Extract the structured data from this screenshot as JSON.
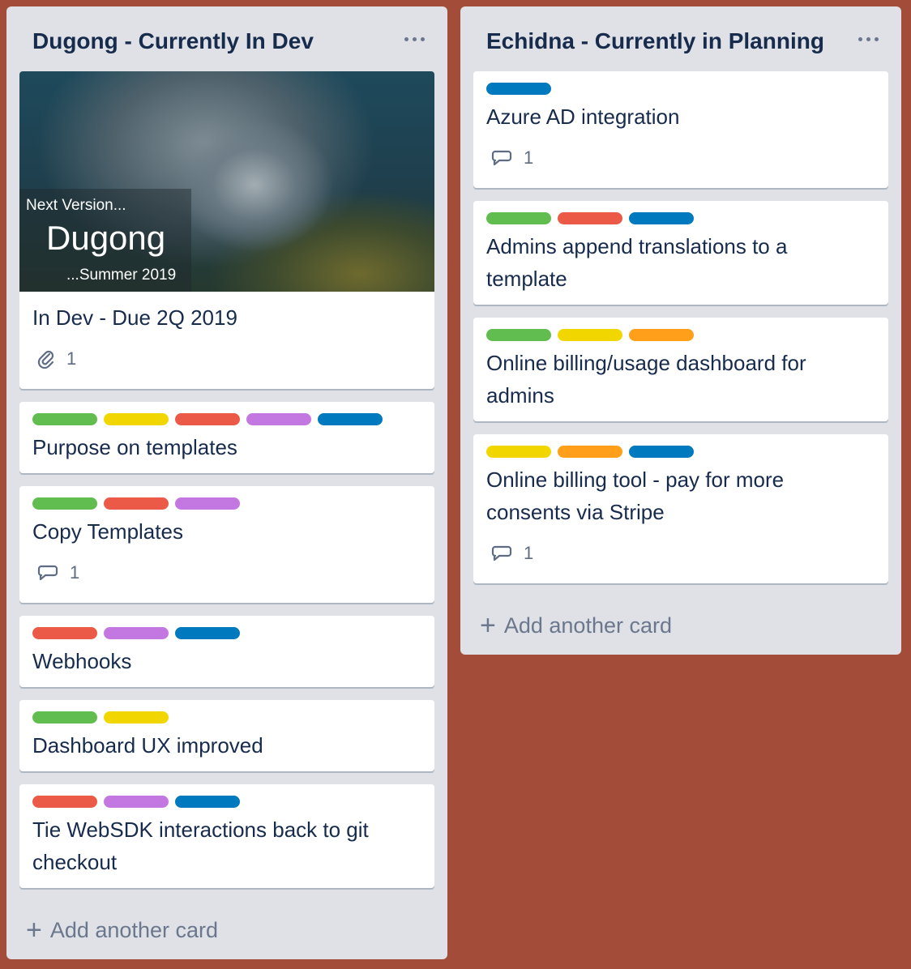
{
  "colors": {
    "board_bg": "#a24c39",
    "green": "#61bd4f",
    "yellow": "#f2d600",
    "red": "#eb5a46",
    "purple": "#c377e0",
    "blue": "#0079bf",
    "orange": "#ff9f1a"
  },
  "lists": [
    {
      "title": "Dugong - Currently In Dev",
      "cover_card": {
        "cover_text_top": "Next Version...",
        "cover_text_big": "Dugong",
        "cover_text_bottom": "...Summer 2019",
        "title": "In Dev - Due 2Q 2019",
        "badge_icon": "paperclip-icon",
        "badge_count": "1"
      },
      "cards": [
        {
          "title": "Purpose on templates",
          "labels": [
            "green",
            "yellow",
            "red",
            "purple",
            "blue"
          ]
        },
        {
          "title": "Copy Templates",
          "labels": [
            "green",
            "red",
            "purple"
          ],
          "badge_icon": "comment-icon",
          "badge_count": "1"
        },
        {
          "title": "Webhooks",
          "labels": [
            "red",
            "purple",
            "blue"
          ]
        },
        {
          "title": "Dashboard UX improved",
          "labels": [
            "green",
            "yellow"
          ]
        },
        {
          "title": "Tie WebSDK interactions back to git checkout",
          "labels": [
            "red",
            "purple",
            "blue"
          ]
        }
      ],
      "add_card_label": "Add another card"
    },
    {
      "title": "Echidna - Currently in Planning",
      "cards": [
        {
          "title": "Azure AD integration",
          "labels": [
            "blue"
          ],
          "badge_icon": "comment-icon",
          "badge_count": "1"
        },
        {
          "title": "Admins append translations to a template",
          "labels": [
            "green",
            "red",
            "blue"
          ]
        },
        {
          "title": "Online billing/usage dashboard for admins",
          "labels": [
            "green",
            "yellow",
            "orange"
          ]
        },
        {
          "title": "Online billing tool - pay for more consents via Stripe",
          "labels": [
            "yellow",
            "orange",
            "blue"
          ],
          "badge_icon": "comment-icon",
          "badge_count": "1"
        }
      ],
      "add_card_label": "Add another card"
    }
  ]
}
